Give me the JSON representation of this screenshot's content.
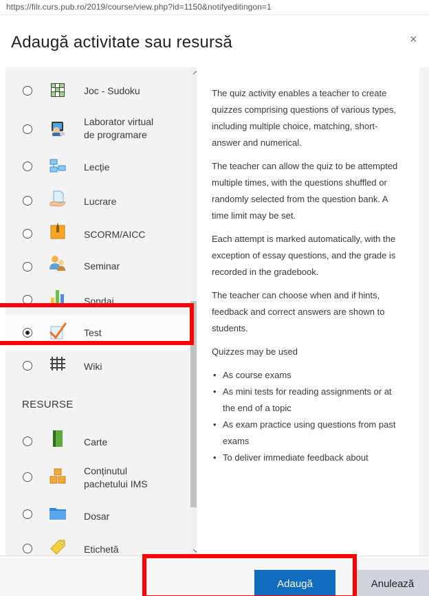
{
  "browser": {
    "url": "https://filr.curs.pub.ro/2019/course/view.php?id=1150&notifyeditingon=1"
  },
  "modal": {
    "title": "Adaugă activitate sau resursă",
    "close_symbol": "×"
  },
  "activities": [
    {
      "label": "Joc - Sudoku",
      "icon": "sudoku-icon",
      "selected": false
    },
    {
      "label": "Laborator virtual",
      "label2": "de programare",
      "icon": "vpl-icon",
      "selected": false
    },
    {
      "label": "Lecție",
      "icon": "lesson-icon",
      "selected": false
    },
    {
      "label": "Lucrare",
      "icon": "assignment-icon",
      "selected": false
    },
    {
      "label": "SCORM/AICC",
      "icon": "scorm-icon",
      "selected": false
    },
    {
      "label": "Seminar",
      "icon": "workshop-icon",
      "selected": false
    },
    {
      "label": "Sondaj",
      "icon": "survey-icon",
      "selected": false
    },
    {
      "label": "Test",
      "icon": "quiz-icon",
      "selected": true
    },
    {
      "label": "Wiki",
      "icon": "wiki-icon",
      "selected": false
    }
  ],
  "resources_header": "RESURSE",
  "resources": [
    {
      "label": "Carte",
      "icon": "book-icon",
      "selected": false
    },
    {
      "label": "Conținutul",
      "label2": "pachetului IMS",
      "icon": "ims-icon",
      "selected": false
    },
    {
      "label": "Dosar",
      "icon": "folder-icon",
      "selected": false
    },
    {
      "label": "Etichetă",
      "icon": "label-icon",
      "selected": false
    }
  ],
  "description": {
    "paragraphs": [
      "The quiz activity enables a teacher to create quizzes comprising questions of various types, including multiple choice, matching, short-answer and numerical.",
      "The teacher can allow the quiz to be attempted multiple times, with the questions shuffled or randomly selected from the question bank. A time limit may be set.",
      "Each attempt is marked automatically, with the exception of essay questions, and the grade is recorded in the gradebook.",
      "The teacher can choose when and if hints, feedback and correct answers are shown to students.",
      "Quizzes may be used"
    ],
    "bullets": [
      "As course exams",
      "As mini tests for reading assignments or at the end of a topic",
      "As exam practice using questions from past exams",
      "To deliver immediate feedback about"
    ]
  },
  "buttons": {
    "add": "Adaugă",
    "cancel": "Anulează"
  },
  "colors": {
    "primary": "#0f6cbf",
    "highlight": "#ff0000",
    "panel_bg": "#f3f3f3"
  }
}
